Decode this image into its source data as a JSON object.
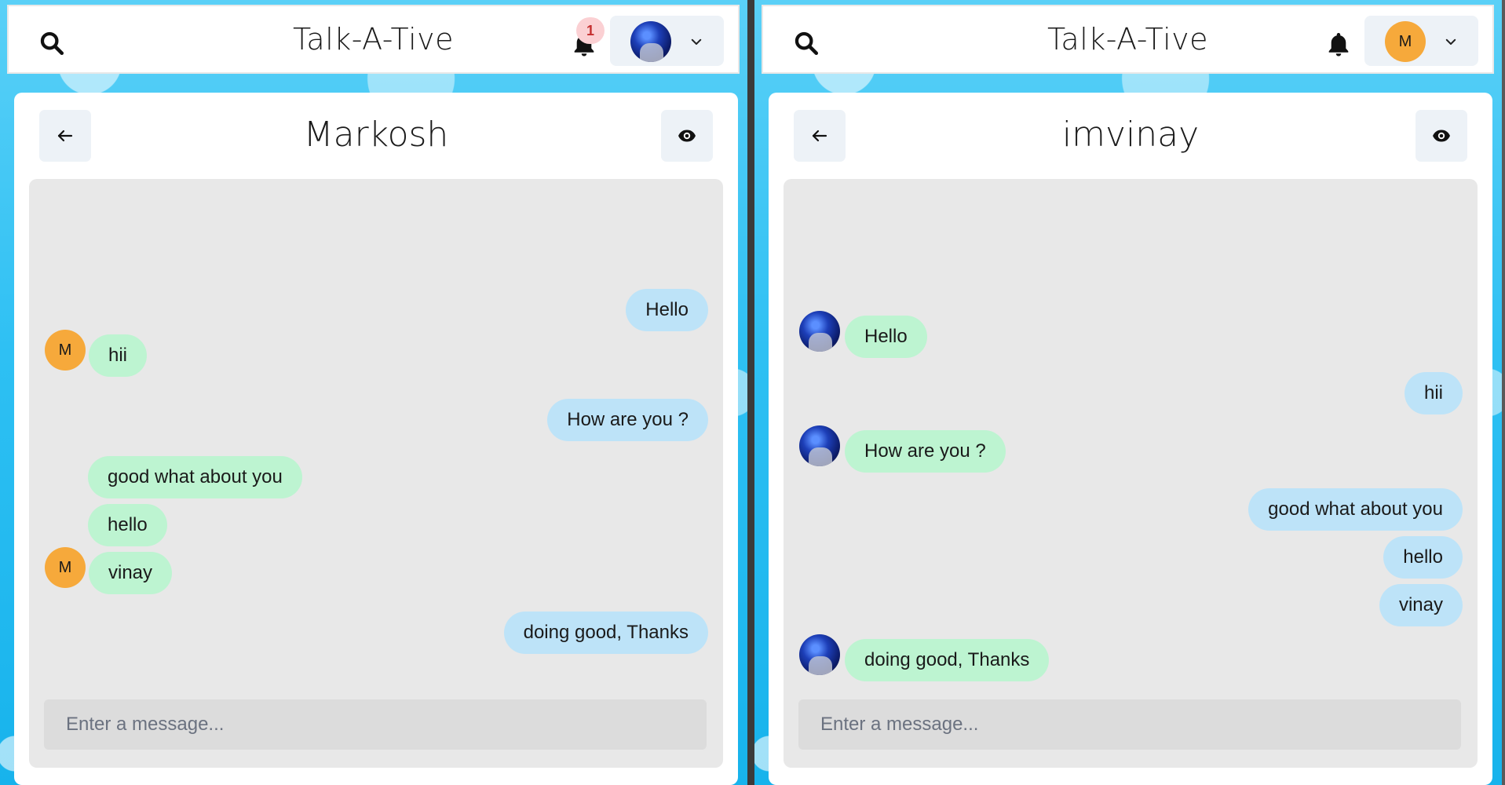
{
  "colors": {
    "incoming_bubble": "#bdf4d1",
    "outgoing_bubble": "#bde3f8",
    "avatar_letter_bg": "#f6a93b",
    "badge_bg": "#fbd0d3",
    "badge_text": "#c53030"
  },
  "left": {
    "app_title": "Talk-A-Tive",
    "notification_count": "1",
    "profile_avatar": "photo",
    "chat_title": "Markosh",
    "input_placeholder": "Enter a message...",
    "messages": [
      {
        "text": "Hello",
        "side": "out"
      },
      {
        "text": "hii",
        "side": "in",
        "avatar": "M"
      },
      {
        "text": "How are you ?",
        "side": "out"
      },
      {
        "text": "good what about you",
        "side": "in"
      },
      {
        "text": "hello",
        "side": "in"
      },
      {
        "text": "vinay",
        "side": "in",
        "avatar": "M"
      },
      {
        "text": "doing good, Thanks",
        "side": "out"
      }
    ]
  },
  "right": {
    "app_title": "Talk-A-Tive",
    "profile_avatar": "M",
    "chat_title": "imvinay",
    "input_placeholder": "Enter a message...",
    "messages": [
      {
        "text": "Hello",
        "side": "in",
        "avatar": "photo"
      },
      {
        "text": "hii",
        "side": "out"
      },
      {
        "text": "How are you ?",
        "side": "in",
        "avatar": "photo"
      },
      {
        "text": "good what about you",
        "side": "out"
      },
      {
        "text": "hello",
        "side": "out"
      },
      {
        "text": "vinay",
        "side": "out"
      },
      {
        "text": "doing good, Thanks",
        "side": "in",
        "avatar": "photo"
      }
    ]
  }
}
